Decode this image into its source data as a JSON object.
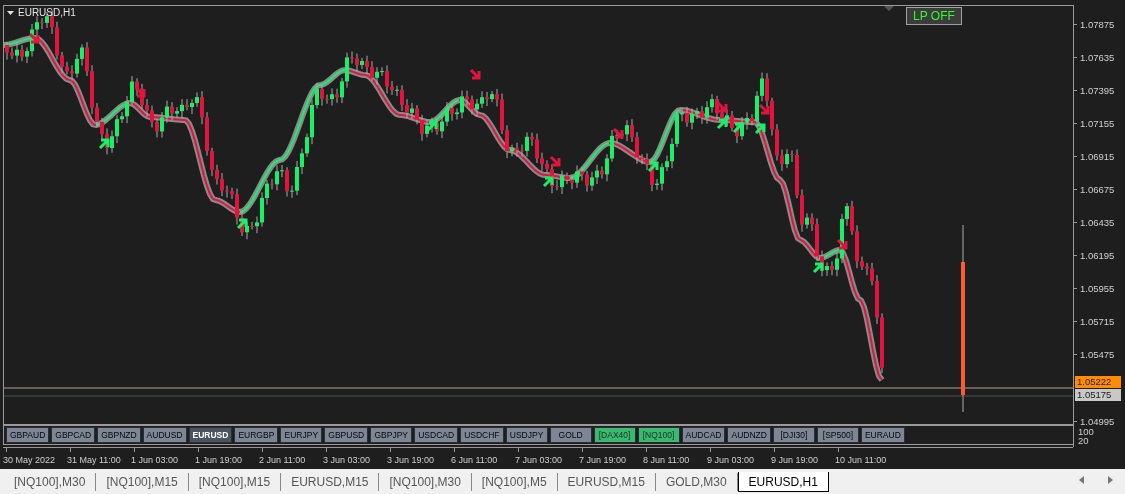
{
  "chart": {
    "title": "EURUSD,H1",
    "lp_button": "LP OFF"
  },
  "price_axis": {
    "labels": [
      "1.07875",
      "1.07635",
      "1.07395",
      "1.07155",
      "1.06915",
      "1.06675",
      "1.06435",
      "1.06195",
      "1.05955",
      "1.05715",
      "1.05475"
    ],
    "ask_label": "1.05222",
    "bid_label": "1.05175",
    "bottom_label": "1.04995"
  },
  "symbol_buttons": [
    {
      "label": "GBPAUD",
      "selected": false,
      "active": false
    },
    {
      "label": "GBPCAD",
      "selected": false,
      "active": false
    },
    {
      "label": "GBPNZD",
      "selected": false,
      "active": false
    },
    {
      "label": "AUDUSD",
      "selected": false,
      "active": false
    },
    {
      "label": "EURUSD",
      "selected": true,
      "active": false
    },
    {
      "label": "EURGBP",
      "selected": false,
      "active": false
    },
    {
      "label": "EURJPY",
      "selected": false,
      "active": false
    },
    {
      "label": "GBPUSD",
      "selected": false,
      "active": false
    },
    {
      "label": "GBPJPY",
      "selected": false,
      "active": false
    },
    {
      "label": "USDCAD",
      "selected": false,
      "active": false
    },
    {
      "label": "USDCHF",
      "selected": false,
      "active": false
    },
    {
      "label": "USDJPY",
      "selected": false,
      "active": false
    },
    {
      "label": "GOLD",
      "selected": false,
      "active": false
    },
    {
      "label": "[DAX40]",
      "selected": false,
      "active": true
    },
    {
      "label": "[NQ100]",
      "selected": false,
      "active": true
    },
    {
      "label": "AUDCAD",
      "selected": false,
      "active": false
    },
    {
      "label": "AUDNZD",
      "selected": false,
      "active": false
    },
    {
      "label": "[DJI30]",
      "selected": false,
      "active": false
    },
    {
      "label": "[SP500]",
      "selected": false,
      "active": false
    },
    {
      "label": "EURAUD",
      "selected": false,
      "active": false
    }
  ],
  "subwindow_axis": [
    "100",
    "20"
  ],
  "time_axis": [
    "30 May 2022",
    "31 May 11:00",
    "1 Jun 03:00",
    "1 Jun 19:00",
    "2 Jun 11:00",
    "3 Jun 03:00",
    "3 Jun 19:00",
    "6 Jun 11:00",
    "7 Jun 03:00",
    "7 Jun 19:00",
    "8 Jun 11:00",
    "9 Jun 03:00",
    "9 Jun 19:00",
    "10 Jun 11:00"
  ],
  "tabs": [
    {
      "label": "[NQ100],M30",
      "selected": false
    },
    {
      "label": "[NQ100],M15",
      "selected": false
    },
    {
      "label": "[NQ100],M15",
      "selected": false
    },
    {
      "label": "EURUSD,M15",
      "selected": false
    },
    {
      "label": "[NQ100],M30",
      "selected": false
    },
    {
      "label": "[NQ100],M5",
      "selected": false
    },
    {
      "label": "EURUSD,M15",
      "selected": false
    },
    {
      "label": "GOLD,M30",
      "selected": false
    },
    {
      "label": "EURUSD,H1",
      "selected": true
    }
  ]
}
